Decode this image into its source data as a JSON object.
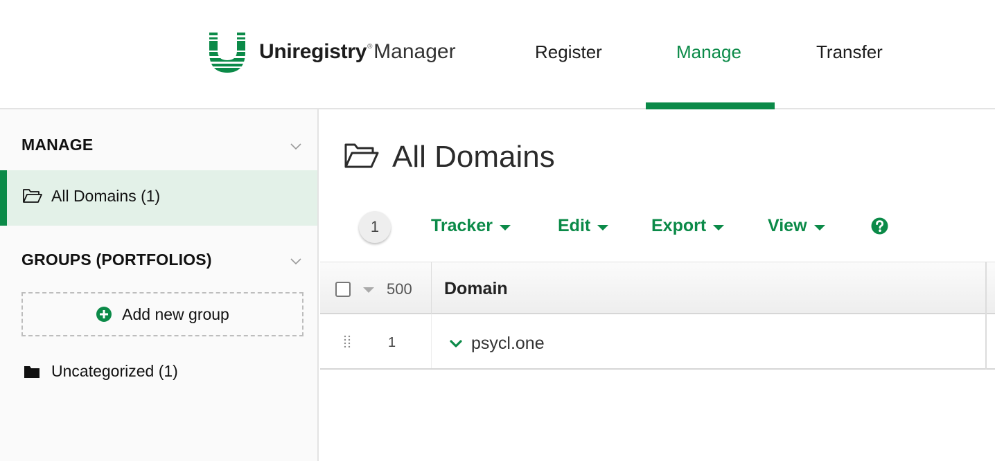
{
  "header": {
    "brand": "Uniregistry",
    "brand_mark": "®",
    "brand_sub": "Manager",
    "nav": [
      {
        "label": "Register",
        "active": false
      },
      {
        "label": "Manage",
        "active": true
      },
      {
        "label": "Transfer",
        "active": false
      }
    ],
    "accent_color": "#0b8a48"
  },
  "sidebar": {
    "manage_heading": "MANAGE",
    "all_domains_label": "All Domains (1)",
    "groups_heading": "GROUPS (PORTFOLIOS)",
    "add_group_label": "Add new group",
    "uncategorized_label": "Uncategorized (1)"
  },
  "main": {
    "title": "All Domains",
    "count_badge": "1",
    "toolbar": {
      "tracker": "Tracker",
      "edit": "Edit",
      "export": "Export",
      "view": "View"
    },
    "icons": {
      "help": "help-circle-icon",
      "folder_open": "folder-open-icon",
      "folder": "folder-icon",
      "add": "plus-circle-icon"
    }
  },
  "table": {
    "page_size": "500",
    "columns": [
      "Domain"
    ],
    "rows": [
      {
        "index": "1",
        "domain": "psycl.one"
      }
    ]
  }
}
